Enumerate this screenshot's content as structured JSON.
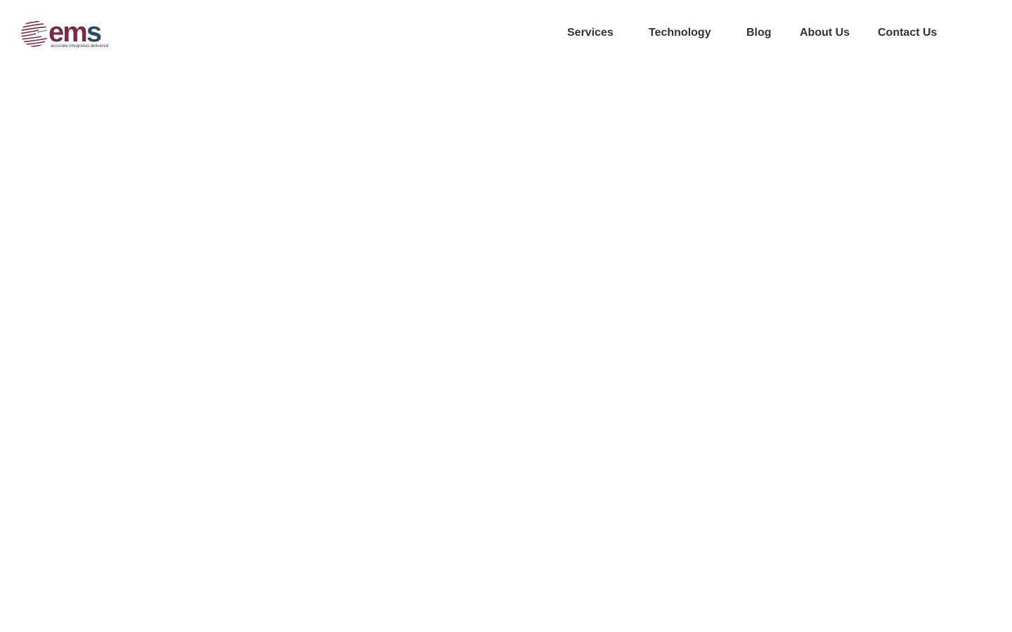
{
  "brand": {
    "logo_text": "ems",
    "tagline": "accurate.integrated.delivered",
    "primary_color": "#7a2a44",
    "secondary_color": "#2a4a63"
  },
  "nav": {
    "items": [
      {
        "label": "Services"
      },
      {
        "label": "Technology"
      },
      {
        "label": "Blog"
      },
      {
        "label": "About Us"
      },
      {
        "label": "Contact Us"
      }
    ],
    "text_color": "#333333"
  }
}
